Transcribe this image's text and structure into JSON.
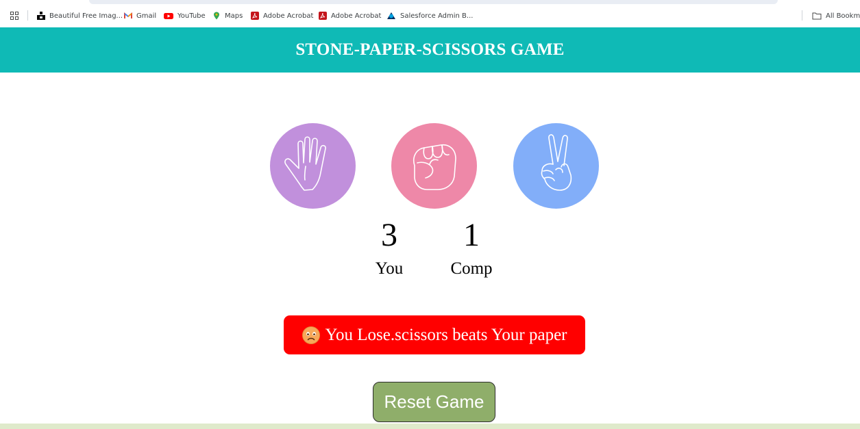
{
  "bookmarks": {
    "items": [
      {
        "label": "Beautiful Free Imag...",
        "icon": "unsplash-icon"
      },
      {
        "label": "Gmail",
        "icon": "gmail-icon"
      },
      {
        "label": "YouTube",
        "icon": "youtube-icon"
      },
      {
        "label": "Maps",
        "icon": "maps-icon"
      },
      {
        "label": "Adobe Acrobat",
        "icon": "acrobat-icon"
      },
      {
        "label": "Adobe Acrobat",
        "icon": "acrobat-icon"
      },
      {
        "label": "Salesforce Admin B...",
        "icon": "salesforce-icon"
      }
    ],
    "all_bookmarks": "All Bookma"
  },
  "game": {
    "title": "STONE-PAPER-SCISSORS GAME",
    "choices": [
      {
        "name": "paper",
        "icon": "hand-paper-icon",
        "color": "#c190dc"
      },
      {
        "name": "stone",
        "icon": "hand-fist-icon",
        "color": "#ee88a8"
      },
      {
        "name": "scissors",
        "icon": "hand-scissors-icon",
        "color": "#82aef9"
      }
    ],
    "user_score": "3",
    "user_label": "You",
    "comp_score": "1",
    "comp_label": "Comp",
    "message": "You Lose.scissors beats Your paper",
    "message_icon": "sad-face-icon",
    "message_color": "#ff0000",
    "reset_label": "Reset Game"
  },
  "colors": {
    "header": "#0fbab6",
    "reset_button": "#8fae6a"
  }
}
